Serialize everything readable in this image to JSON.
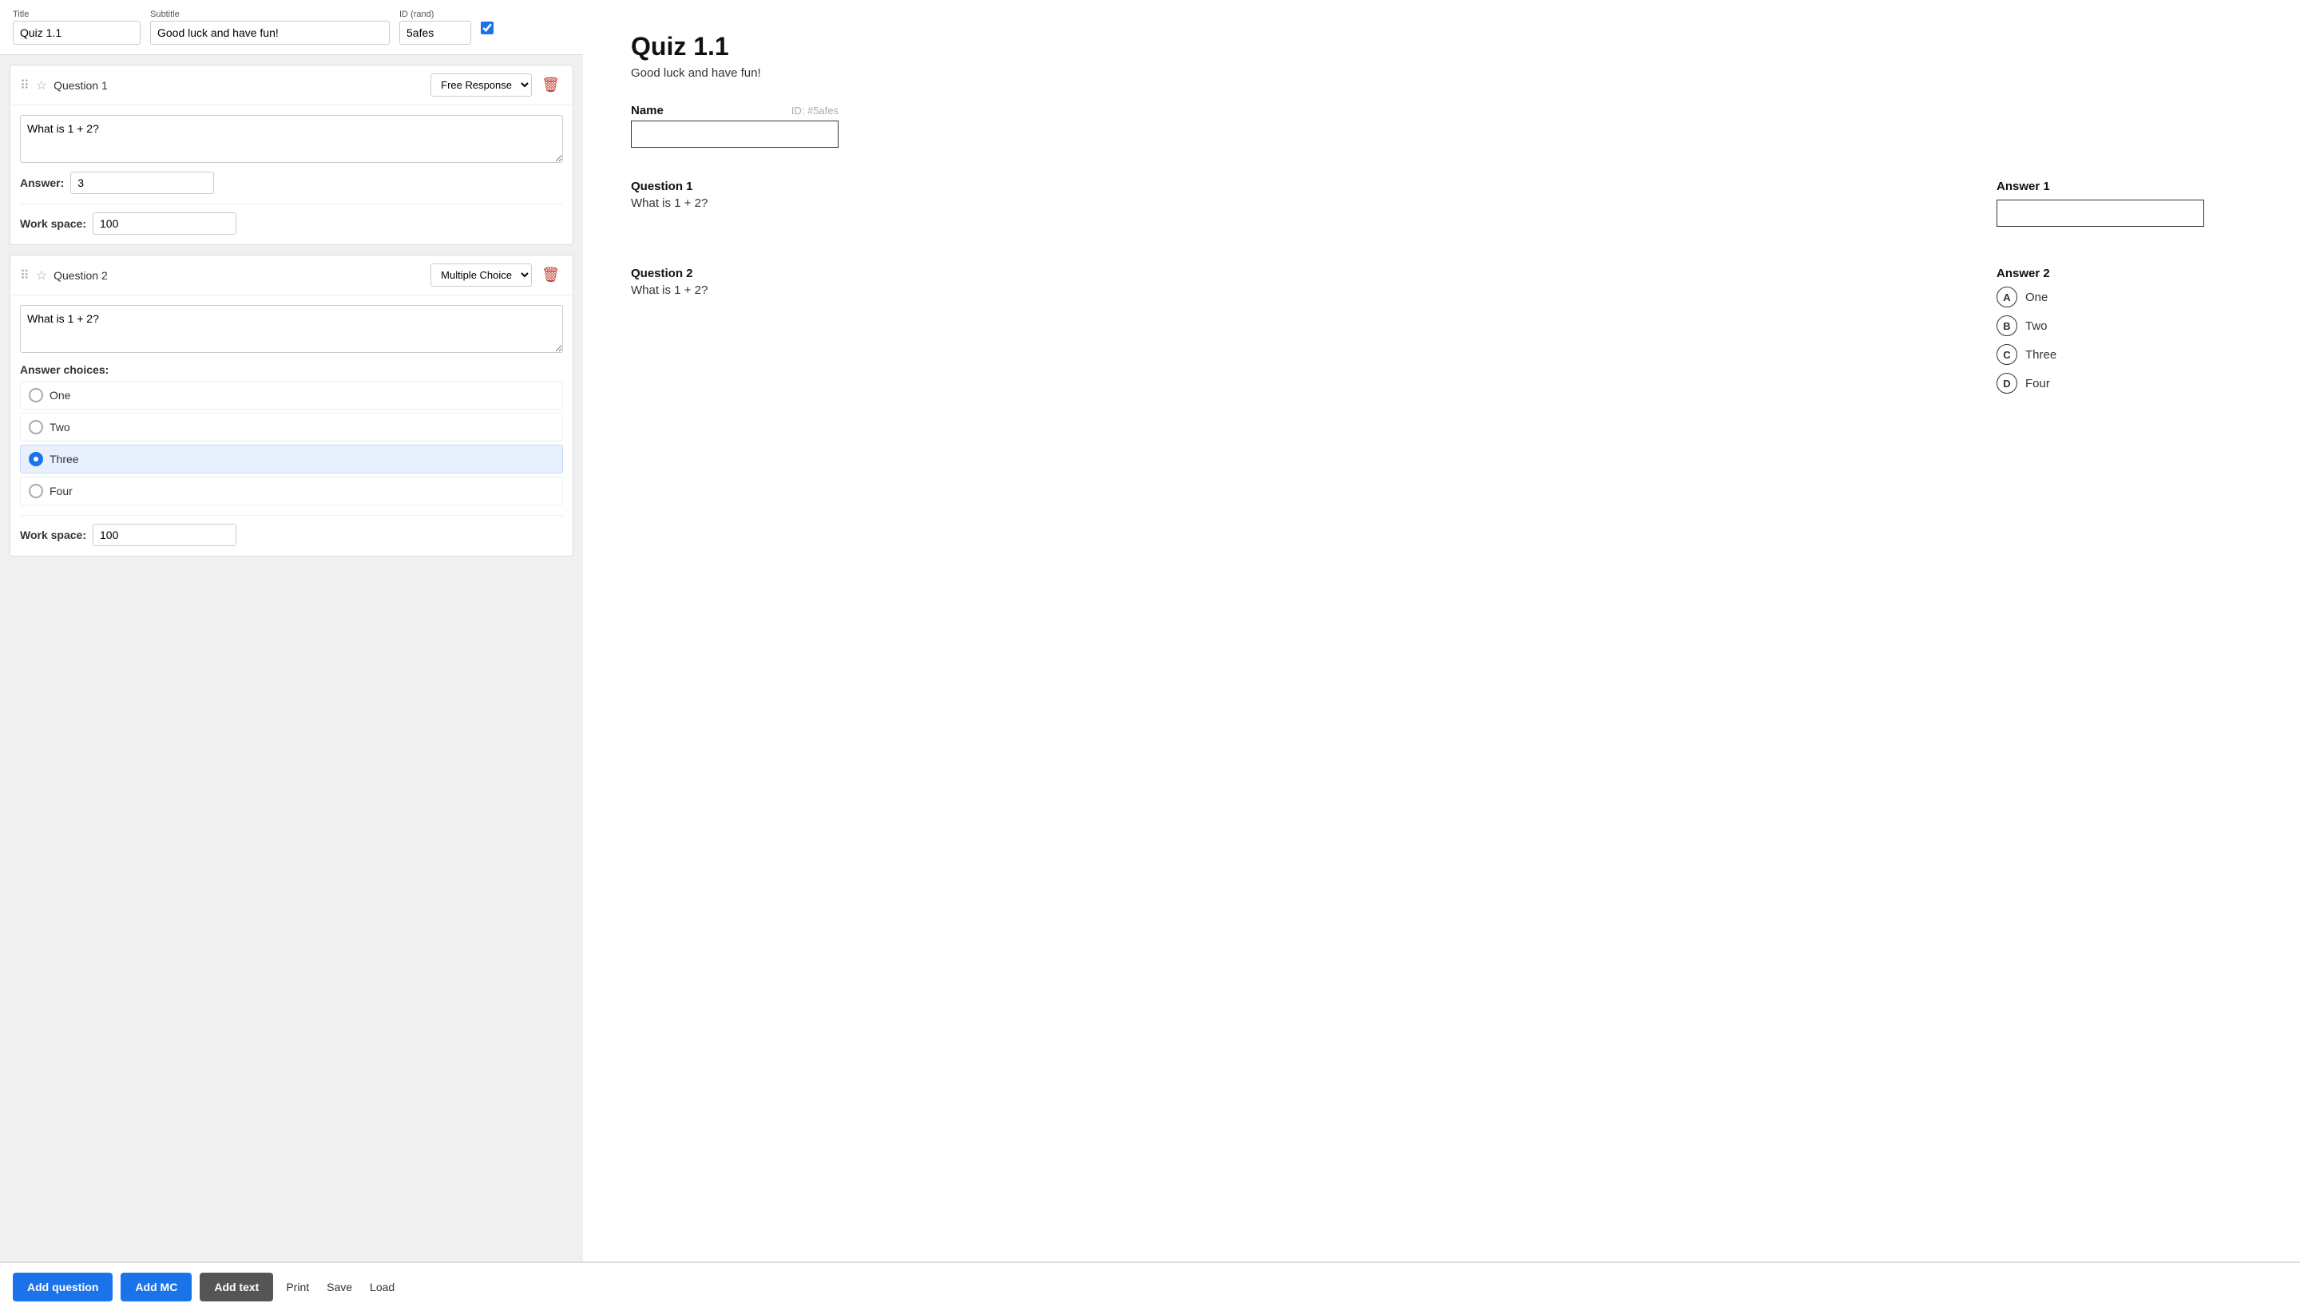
{
  "header": {
    "title_label": "Title",
    "subtitle_label": "Subtitle",
    "id_label": "ID (rand)",
    "title_value": "Quiz 1.1",
    "subtitle_value": "Good luck and have fun!",
    "id_value": "5afes",
    "rand_checked": true
  },
  "questions": [
    {
      "id": 1,
      "label": "Question 1",
      "type": "Free Response",
      "text": "What is 1 + 2?",
      "answer_label": "Answer:",
      "answer_value": "3",
      "workspace_label": "Work space:",
      "workspace_value": "100",
      "choices": []
    },
    {
      "id": 2,
      "label": "Question 2",
      "type": "Multiple Choice",
      "text": "What is 1 + 2?",
      "answer_label": "",
      "answer_value": "",
      "workspace_label": "Work space:",
      "workspace_value": "100",
      "answer_choices_label": "Answer choices:",
      "choices": [
        {
          "text": "One",
          "selected": false
        },
        {
          "text": "Two",
          "selected": false
        },
        {
          "text": "Three",
          "selected": true
        },
        {
          "text": "Four",
          "selected": false
        }
      ]
    }
  ],
  "toolbar": {
    "add_question_label": "Add question",
    "add_mc_label": "Add MC",
    "add_text_label": "Add text",
    "print_label": "Print",
    "save_label": "Save",
    "load_label": "Load"
  },
  "preview": {
    "title": "Quiz 1.1",
    "subtitle": "Good luck and have fun!",
    "name_label": "Name",
    "id_label": "ID: #5afes",
    "questions": [
      {
        "label": "Question 1",
        "text": "What is 1 + 2?",
        "answer_label": "Answer 1"
      },
      {
        "label": "Question 2",
        "text": "What is 1 + 2?",
        "answer_label": "Answer 2",
        "choices": [
          {
            "letter": "A",
            "text": "One"
          },
          {
            "letter": "B",
            "text": "Two"
          },
          {
            "letter": "C",
            "text": "Three"
          },
          {
            "letter": "D",
            "text": "Four"
          }
        ]
      }
    ]
  }
}
